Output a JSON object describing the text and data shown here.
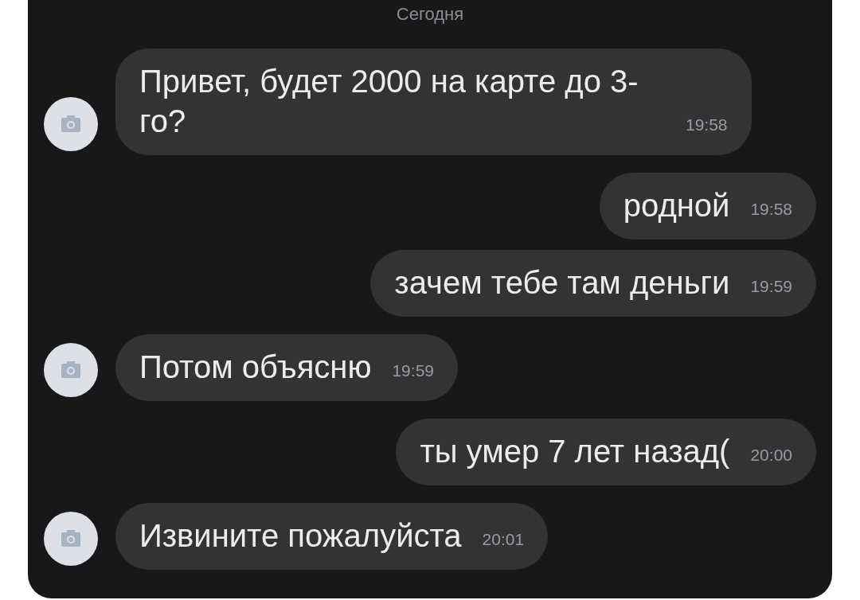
{
  "date_header": "Сегодня",
  "messages": [
    {
      "kind": "incoming",
      "text": "Привет, будет 2000 на карте до 3-го?",
      "time": "19:58"
    },
    {
      "kind": "outgoing",
      "text": "родной",
      "time": "19:58"
    },
    {
      "kind": "outgoing",
      "text": "зачем тебе там деньги",
      "time": "19:59"
    },
    {
      "kind": "incoming",
      "text": "Потом объясню",
      "time": "19:59"
    },
    {
      "kind": "outgoing",
      "text": "ты умер 7 лет назад(",
      "time": "20:00"
    },
    {
      "kind": "incoming",
      "text": "Извините пожалуйста",
      "time": "20:01"
    }
  ]
}
